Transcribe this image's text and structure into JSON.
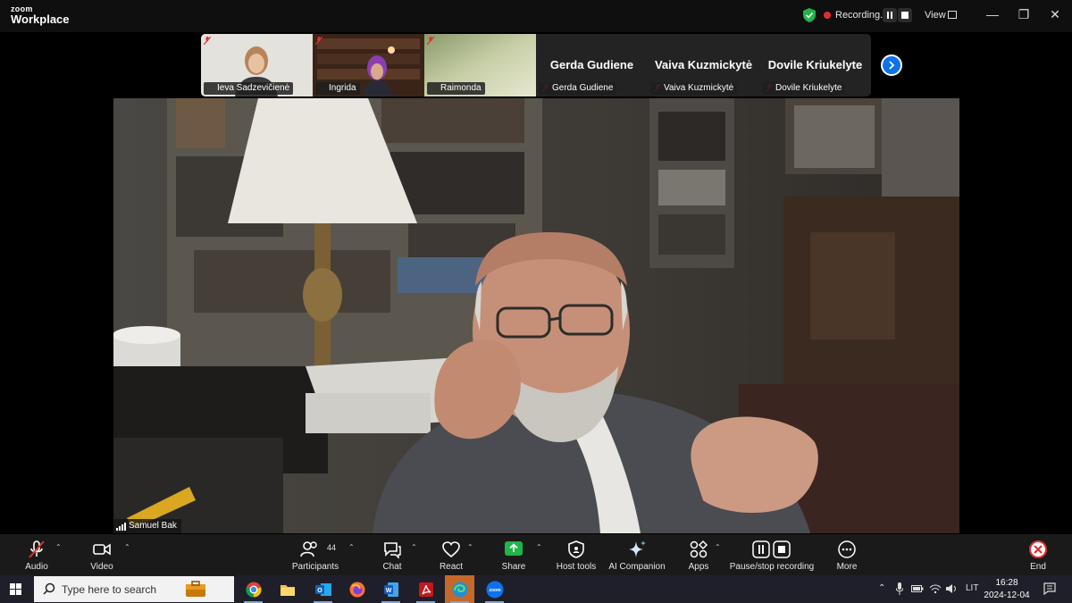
{
  "app": {
    "logo_line1": "zoom",
    "logo_line2": "Workplace"
  },
  "titlebar": {
    "recording_label": "Recording...",
    "view_label": "View"
  },
  "gallery": {
    "tiles": [
      {
        "name": "Ieva Sadzevičienė",
        "muted": true,
        "has_video": true
      },
      {
        "name": "Ingrida",
        "muted": true,
        "has_video": true
      },
      {
        "name": "Raimonda",
        "muted": true,
        "has_video": true
      },
      {
        "name": "Gerda Gudiene",
        "big_name": "Gerda Gudiene",
        "muted": true,
        "has_video": false
      },
      {
        "name": "Vaiva Kuzmickytė",
        "big_name": "Vaiva Kuzmickytė",
        "muted": true,
        "has_video": false
      },
      {
        "name": "Dovile Kriukelyte",
        "big_name": "Dovile Kriukelyte",
        "muted": true,
        "has_video": false
      }
    ]
  },
  "active_speaker": {
    "name": "Samuel Bak"
  },
  "toolbar": {
    "audio": "Audio",
    "video": "Video",
    "participants": "Participants",
    "participant_count": "44",
    "chat": "Chat",
    "react": "React",
    "share": "Share",
    "host_tools": "Host tools",
    "ai_companion": "AI Companion",
    "apps": "Apps",
    "recording": "Pause/stop recording",
    "more": "More",
    "end": "End"
  },
  "taskbar": {
    "search_placeholder": "Type here to search",
    "language": "LIT",
    "time": "16:28",
    "date": "2024-12-04"
  },
  "colors": {
    "accent": "#0e72ed",
    "share_green": "#1fb548",
    "end_red": "#e02f2f",
    "shield_green": "#24b24b"
  }
}
